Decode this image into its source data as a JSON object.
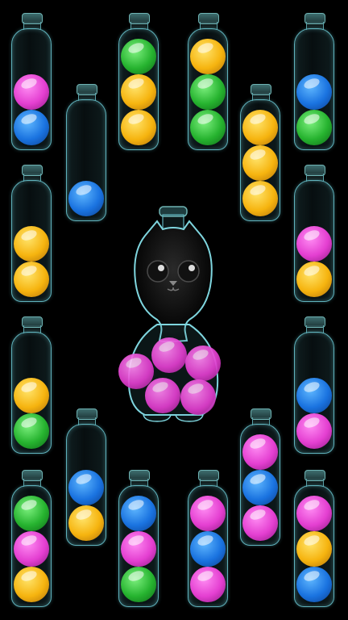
{
  "game": {
    "colors": {
      "blue": "#1a73e0",
      "pink": "#e43fd1",
      "green": "#26b32f",
      "yellow": "#f6b40f",
      "glass": "#5fb1bb"
    },
    "bottles": [
      {
        "id": "b1",
        "balls": [
          "blue",
          "pink"
        ]
      },
      {
        "id": "b2",
        "balls": [
          "blue"
        ]
      },
      {
        "id": "b3",
        "balls": [
          "yellow",
          "yellow",
          "green"
        ]
      },
      {
        "id": "b4",
        "balls": [
          "green",
          "green",
          "yellow"
        ]
      },
      {
        "id": "b5",
        "balls": [
          "yellow",
          "yellow",
          "yellow"
        ]
      },
      {
        "id": "b6",
        "balls": [
          "green",
          "blue"
        ]
      },
      {
        "id": "b7",
        "balls": [
          "yellow",
          "yellow"
        ]
      },
      {
        "id": "b8",
        "balls": [
          "yellow",
          "pink"
        ]
      },
      {
        "id": "b9",
        "balls": [
          "green",
          "yellow"
        ]
      },
      {
        "id": "b10",
        "balls": [
          "pink",
          "blue"
        ]
      },
      {
        "id": "b11",
        "balls": [
          "yellow",
          "blue"
        ]
      },
      {
        "id": "b12",
        "balls": [
          "pink",
          "blue",
          "pink"
        ]
      },
      {
        "id": "b13",
        "balls": [
          "yellow",
          "pink",
          "green"
        ]
      },
      {
        "id": "b14",
        "balls": [
          "green",
          "pink",
          "blue"
        ]
      },
      {
        "id": "b15",
        "balls": [
          "pink",
          "blue",
          "pink"
        ]
      },
      {
        "id": "b16",
        "balls": [
          "blue",
          "yellow",
          "pink"
        ]
      }
    ],
    "cat_bottle": {
      "balls": [
        "pink",
        "pink",
        "pink",
        "pink",
        "pink"
      ]
    }
  }
}
